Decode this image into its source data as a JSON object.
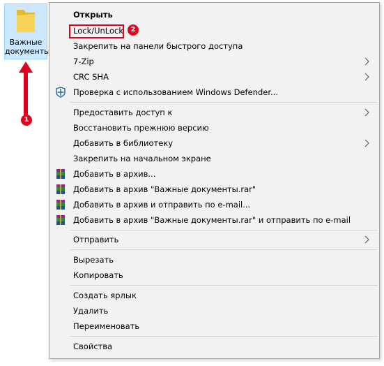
{
  "desktop": {
    "folder_label": "Важные документы"
  },
  "annotations": {
    "badge_1": "1",
    "badge_2": "2",
    "accent_color": "#e2001a"
  },
  "menu": {
    "items": [
      {
        "label": "Открыть",
        "bold": true
      },
      {
        "label": "Lock/UnLock"
      },
      {
        "label": "Закрепить на панели быстрого доступа"
      },
      {
        "label": "7-Zip"
      },
      {
        "label": "CRC SHA"
      },
      {
        "label": "Проверка с использованием Windows Defender..."
      },
      {
        "label": "Предоставить доступ к"
      },
      {
        "label": "Восстановить прежнюю версию"
      },
      {
        "label": "Добавить в библиотеку"
      },
      {
        "label": "Закрепить на начальном экране"
      },
      {
        "label": "Добавить в архив..."
      },
      {
        "label": "Добавить в архив \"Важные документы.rar\""
      },
      {
        "label": "Добавить в архив и отправить по e-mail..."
      },
      {
        "label": "Добавить в архив \"Важные документы.rar\" и отправить по e-mail"
      },
      {
        "label": "Отправить"
      },
      {
        "label": "Вырезать"
      },
      {
        "label": "Копировать"
      },
      {
        "label": "Создать ярлык"
      },
      {
        "label": "Удалить"
      },
      {
        "label": "Переименовать"
      },
      {
        "label": "Свойства"
      }
    ]
  }
}
